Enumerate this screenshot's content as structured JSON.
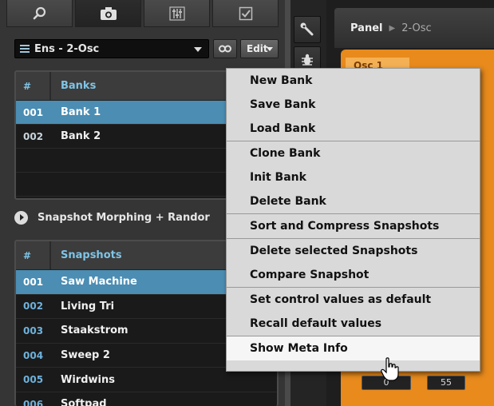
{
  "tabs": [
    {
      "name": "search",
      "icon": "search-icon"
    },
    {
      "name": "snapshot",
      "icon": "camera-icon"
    },
    {
      "name": "mixer",
      "icon": "sliders-icon"
    },
    {
      "name": "checklist",
      "icon": "checkbox-icon"
    }
  ],
  "selector": {
    "ensemble": "Ens - 2-Osc",
    "edit_label": "Edit"
  },
  "banks": {
    "header_hash": "#",
    "header_title": "Banks",
    "rows": [
      {
        "num": "001",
        "name": "Bank 1",
        "selected": true
      },
      {
        "num": "002",
        "name": "Bank 2",
        "selected": false
      }
    ]
  },
  "morph": {
    "label": "Snapshot Morphing + Randor"
  },
  "snapshots": {
    "header_hash": "#",
    "header_title": "Snapshots",
    "rows": [
      {
        "num": "001",
        "name": "Saw Machine",
        "selected": true
      },
      {
        "num": "002",
        "name": "Living Tri",
        "selected": false
      },
      {
        "num": "003",
        "name": "Staakstrom",
        "selected": false
      },
      {
        "num": "004",
        "name": "Sweep 2",
        "selected": false
      },
      {
        "num": "005",
        "name": "Wirdwins",
        "selected": false
      },
      {
        "num": "006",
        "name": "Softpad",
        "selected": false
      }
    ]
  },
  "panel": {
    "title": "Panel",
    "breadcrumb": "2-Osc",
    "osc_tab": "Osc 1",
    "values": [
      "0",
      "55"
    ]
  },
  "menu": {
    "items": [
      "New Bank",
      "Save Bank",
      "Load Bank",
      "Clone Bank",
      "Init Bank",
      "Delete Bank",
      "Sort and Compress Snapshots",
      "Delete selected Snapshots",
      "Compare Snapshot",
      "Set control values as default",
      "Recall default values",
      "Show Meta Info"
    ],
    "highlighted_index": 11
  },
  "colors": {
    "selection": "#4b8db3",
    "accent_text": "#7fc4e6",
    "panel_orange": "#e88a1c",
    "menu_bg": "#d9d9d9"
  }
}
